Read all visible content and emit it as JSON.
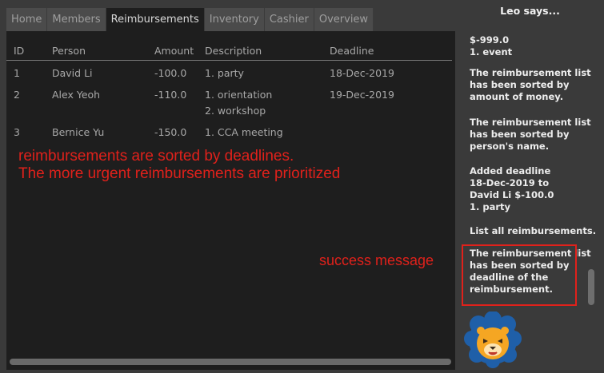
{
  "tabs": [
    {
      "label": "Home",
      "active": false
    },
    {
      "label": "Members",
      "active": false
    },
    {
      "label": "Reimbursements",
      "active": true
    },
    {
      "label": "Inventory",
      "active": false
    },
    {
      "label": "Cashier",
      "active": false
    },
    {
      "label": "Overview",
      "active": false
    }
  ],
  "table": {
    "headers": [
      "ID",
      "Person",
      "Amount",
      "Description",
      "Deadline"
    ],
    "rows": [
      {
        "id": "1",
        "person": "David Li",
        "amount": "-100.0",
        "description": [
          "1. party"
        ],
        "deadline": "18-Dec-2019"
      },
      {
        "id": "2",
        "person": "Alex Yeoh",
        "amount": "-110.0",
        "description": [
          "1. orientation",
          "2. workshop"
        ],
        "deadline": "19-Dec-2019"
      },
      {
        "id": "3",
        "person": "Bernice Yu",
        "amount": "-150.0",
        "description": [
          "1. CCA meeting"
        ],
        "deadline": ""
      }
    ]
  },
  "annotations": {
    "sorted_line1": "reimbursements are sorted by deadlines.",
    "sorted_line2": "The more urgent reimbursements are prioritized",
    "success": "success message"
  },
  "assistant": {
    "title": "Leo says...",
    "messages": [
      [
        "$-999.0",
        "1. event"
      ],
      [
        "The reimbursement list",
        "has been sorted by",
        "amount of money."
      ],
      [
        "The reimbursement list",
        "has been sorted by",
        "person's name."
      ],
      [
        "Added deadline",
        "18-Dec-2019 to",
        "David Li $-100.0",
        "1. party"
      ],
      [
        "List all reimbursements."
      ],
      [
        "The reimbursement list",
        "has been sorted by",
        "deadline of the",
        "reimbursement."
      ]
    ]
  },
  "mascot_icon": "lion-icon",
  "colors": {
    "annotation": "#e0211b",
    "lion_face": "#f5a623",
    "lion_mane": "#1f5fa8"
  }
}
